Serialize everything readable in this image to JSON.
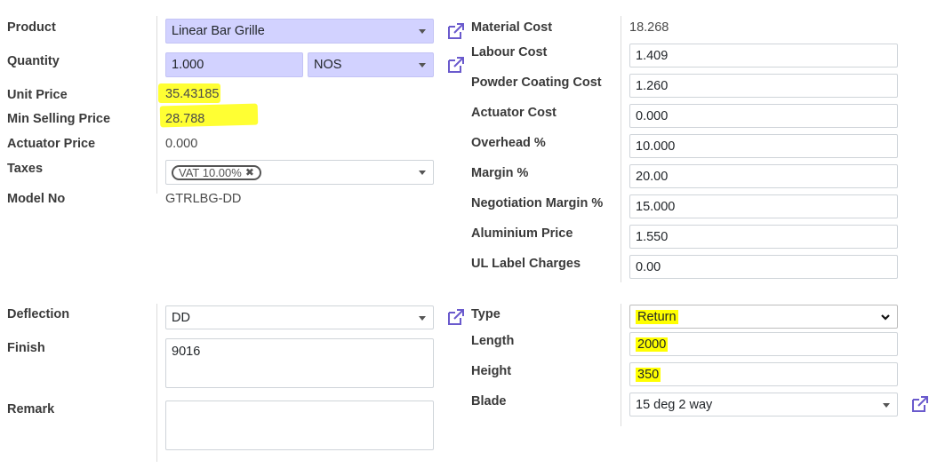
{
  "left_fields": {
    "product": {
      "label": "Product",
      "value": "Linear Bar Grille"
    },
    "quantity": {
      "label": "Quantity",
      "value": "1.000",
      "uom": "NOS"
    },
    "unit_price": {
      "label": "Unit Price",
      "value": "35.43185"
    },
    "min_selling_price": {
      "label": "Min Selling Price",
      "value": "28.788"
    },
    "actuator_price": {
      "label": "Actuator Price",
      "value": "0.000"
    },
    "taxes": {
      "label": "Taxes",
      "tag": "VAT 10.00%",
      "remove_glyph": "✖"
    },
    "model_no": {
      "label": "Model No",
      "value": "GTRLBG-DD"
    }
  },
  "right_fields": {
    "material_cost": {
      "label": "Material Cost",
      "value": "18.268"
    },
    "labour_cost": {
      "label": "Labour Cost",
      "value": "1.409"
    },
    "powder_coating_cost": {
      "label": "Powder Coating Cost",
      "value": "1.260"
    },
    "actuator_cost": {
      "label": "Actuator Cost",
      "value": "0.000"
    },
    "overhead": {
      "label": "Overhead %",
      "value": "10.000"
    },
    "margin": {
      "label": "Margin %",
      "value": "20.00"
    },
    "negotiation_margin": {
      "label": "Negotiation Margin %",
      "value": "15.000"
    },
    "aluminium_price": {
      "label": "Aluminium Price",
      "value": "1.550"
    },
    "ul_label_charges": {
      "label": "UL Label Charges",
      "value": "0.00"
    }
  },
  "lower_left": {
    "deflection": {
      "label": "Deflection",
      "value": "DD"
    },
    "finish": {
      "label": "Finish",
      "value": "9016"
    },
    "remark": {
      "label": "Remark",
      "value": ""
    }
  },
  "lower_right": {
    "type": {
      "label": "Type",
      "value": "Return"
    },
    "length": {
      "label": "Length",
      "value": "2000"
    },
    "height": {
      "label": "Height",
      "value": "350"
    },
    "blade": {
      "label": "Blade",
      "value": "15 deg 2 way"
    }
  },
  "colors": {
    "required_bg": "#d2d2ff",
    "highlight": "#ffff00",
    "link_icon": "#6a5acd"
  },
  "icons": {
    "external_link": "external-link-icon",
    "dropdown": "caret-down-icon"
  }
}
